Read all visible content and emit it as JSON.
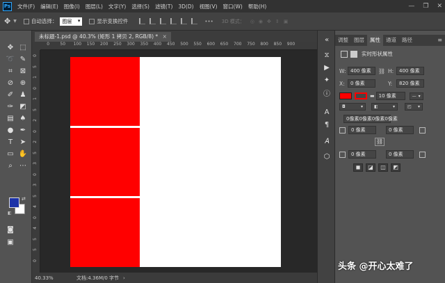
{
  "app": {
    "logo_text": "Ps"
  },
  "menu": [
    "文件(F)",
    "编辑(E)",
    "图像(I)",
    "图层(L)",
    "文字(Y)",
    "选择(S)",
    "滤镜(T)",
    "3D(D)",
    "视图(V)",
    "窗口(W)",
    "帮助(H)"
  ],
  "window_controls": {
    "minimize": "—",
    "restore": "❐",
    "close": "✕"
  },
  "options_bar": {
    "auto_select_label": "自动选择：",
    "auto_select_value": "图层",
    "show_transform_label": "显示变换控件",
    "more_label": "•••",
    "mode_3d_label": "3D 模式："
  },
  "document": {
    "tab_title": "未标题-1.psd @ 40.3% (矩形 1 拷贝 2, RGB/8) *",
    "close_glyph": "×"
  },
  "ruler": {
    "h_labels": [
      "50",
      "0",
      "50",
      "100",
      "150",
      "200",
      "250",
      "300",
      "350",
      "400",
      "450",
      "500",
      "550",
      "600",
      "650",
      "700",
      "750",
      "800",
      "850",
      "900"
    ],
    "v_labels": [
      "0",
      "5",
      "1",
      "0",
      "1",
      "5",
      "2",
      "0",
      "2",
      "5",
      "3",
      "0",
      "3",
      "5",
      "4",
      "0",
      "4",
      "5",
      "5",
      "0"
    ]
  },
  "canvas": {
    "background_color": "#ffffff",
    "shape_color": "#ff0000",
    "workspace_color": "#282828"
  },
  "status": {
    "zoom": "40.33%",
    "doc_info": "文档:4.36M/0 字节",
    "arrow": "›"
  },
  "panel": {
    "tabs": [
      "调整",
      "图层",
      "属性",
      "通道",
      "路径"
    ],
    "active_tab": "属性",
    "menu_glyph": "≡",
    "title": "实时形状属性",
    "w_label": "W:",
    "w_value": "400 像素",
    "h_label": "H:",
    "h_value": "400 像素",
    "x_label": "X:",
    "x_value": "0 像素",
    "y_label": "Y:",
    "y_value": "820 像素",
    "fill_color": "#ff0000",
    "stroke_width": "10 像素",
    "corner_all": "0像素0像素0像素0像素",
    "corner_tl": "0 像素",
    "corner_tr": "0 像素",
    "corner_bl": "0 像素",
    "corner_br": "0 像素"
  },
  "toolbar": {
    "fg_color": "#1c32a8",
    "bg_color": "#ffffff"
  },
  "watermark": "头条 @开心太难了"
}
